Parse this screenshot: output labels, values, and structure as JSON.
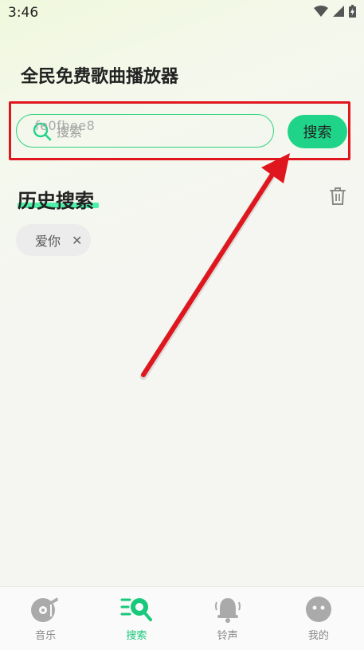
{
  "status_bar": {
    "time": "3:46"
  },
  "app": {
    "title": "全民免费歌曲播放器"
  },
  "search": {
    "placeholder": "搜索",
    "value": "",
    "watermark": "fe0fbee8",
    "button_label": "搜索"
  },
  "history": {
    "title": "历史搜索",
    "items": [
      {
        "label": "爱你",
        "close": "✕"
      }
    ]
  },
  "tab_bar": {
    "tabs": [
      {
        "label": "音乐",
        "icon": "music-disc-icon",
        "active": false
      },
      {
        "label": "搜索",
        "icon": "search-tab-icon",
        "active": true
      },
      {
        "label": "铃声",
        "icon": "bell-icon",
        "active": false
      },
      {
        "label": "我的",
        "icon": "profile-face-icon",
        "active": false
      }
    ]
  },
  "colors": {
    "accent": "#1fd488",
    "highlight": "#e0161e",
    "text": "#222222",
    "inactive": "#aaaaaa"
  }
}
